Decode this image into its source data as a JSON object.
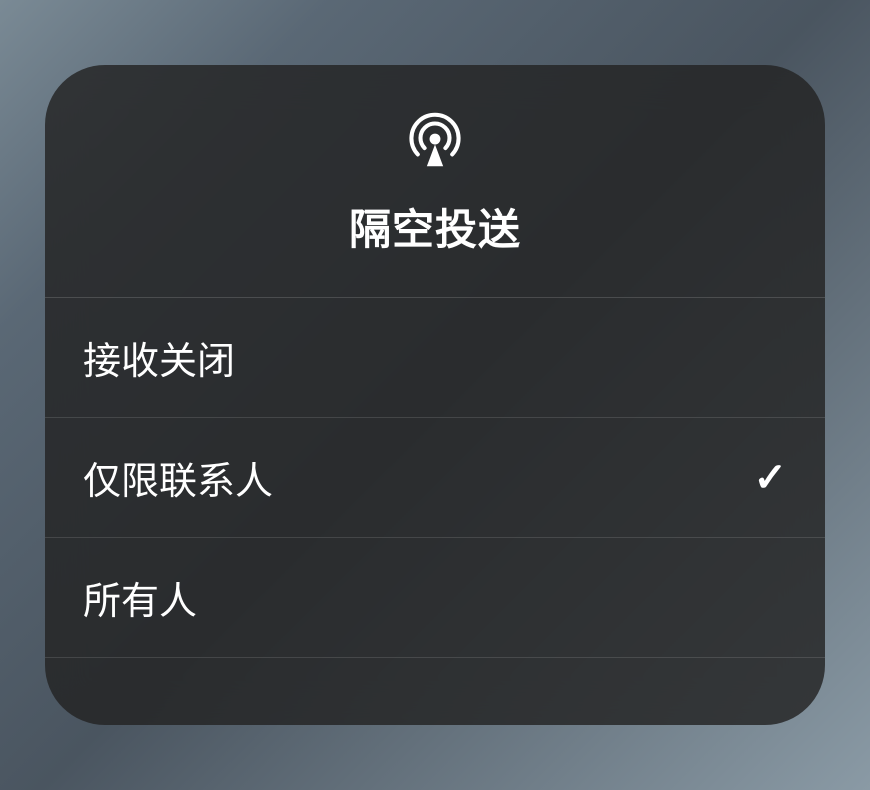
{
  "panel": {
    "title": "隔空投送",
    "icon_name": "airdrop-icon",
    "options": [
      {
        "label": "接收关闭",
        "selected": false
      },
      {
        "label": "仅限联系人",
        "selected": true
      },
      {
        "label": "所有人",
        "selected": false
      }
    ]
  }
}
